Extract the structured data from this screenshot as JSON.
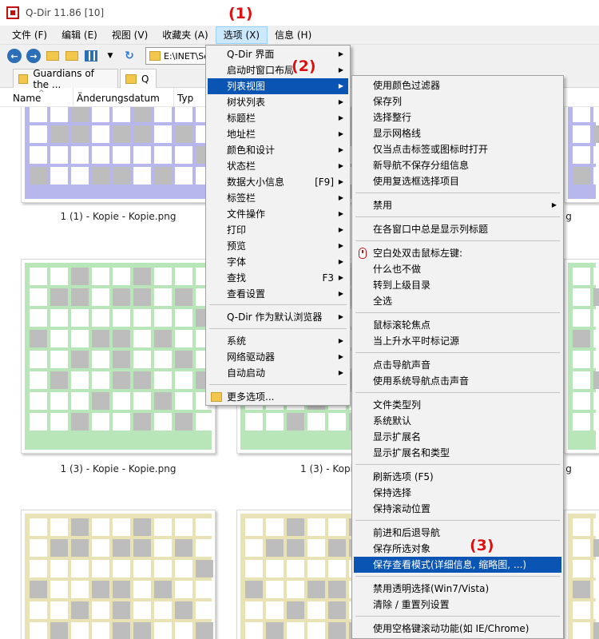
{
  "window": {
    "title": "Q-Dir 11.86 [10]"
  },
  "menubar": [
    {
      "label": "文件 (F)"
    },
    {
      "label": "编辑 (E)"
    },
    {
      "label": "视图 (V)"
    },
    {
      "label": "收藏夹 (A)"
    },
    {
      "label": "选项 (X)"
    },
    {
      "label": "信息 (H)"
    }
  ],
  "toolbar": {
    "address": "E:\\INET\\So"
  },
  "tabs": [
    {
      "label": "Guardians of the ..."
    },
    {
      "label": "Q"
    }
  ],
  "columns": [
    {
      "label": "Name"
    },
    {
      "label": "Änderungsdatum"
    },
    {
      "label": "Typ"
    }
  ],
  "files": [
    {
      "caption": "1 (1) - Kopie - Kopie.png",
      "color": "#b7b7ee"
    },
    {
      "caption": "1 (3) - Kopie - Kopie.png",
      "color": "#b8e6b8"
    },
    {
      "caption": "1 (3) - Kopie",
      "color": "#b8e6b8"
    },
    {
      "caption": "",
      "color": "#e8e2b4"
    },
    {
      "caption": "",
      "color": "#e8e2b4"
    }
  ],
  "captions_right": {
    "row1": "g",
    "row2": "g"
  },
  "options_menu": [
    {
      "label": "Q-Dir 界面",
      "arrow": true
    },
    {
      "label": "启动时窗口布局",
      "arrow": true
    },
    {
      "label": "列表视图",
      "arrow": true,
      "highlight": true
    },
    {
      "label": "树状列表",
      "arrow": true
    },
    {
      "label": "标题栏",
      "arrow": true
    },
    {
      "label": "地址栏",
      "arrow": true
    },
    {
      "label": "颜色和设计",
      "arrow": true
    },
    {
      "label": "状态栏",
      "arrow": true
    },
    {
      "label": "数据大小信息",
      "shortcut": "[F9]",
      "arrow": true
    },
    {
      "label": "标签栏",
      "arrow": true
    },
    {
      "label": "文件操作",
      "arrow": true
    },
    {
      "label": "打印",
      "arrow": true
    },
    {
      "label": "预览",
      "arrow": true
    },
    {
      "label": "字体",
      "arrow": true
    },
    {
      "label": "查找",
      "shortcut": "F3",
      "arrow": true
    },
    {
      "label": "查看设置",
      "arrow": true
    },
    {
      "label": "Q-Dir 作为默认浏览器",
      "arrow": true
    },
    {
      "label": "系统",
      "arrow": true
    },
    {
      "label": "网络驱动器",
      "arrow": true
    },
    {
      "label": "自动启动",
      "arrow": true
    },
    {
      "label": "更多选项...",
      "arrow": false,
      "folder_icon": true
    }
  ],
  "listview_menu": [
    {
      "label": "使用颜色过滤器"
    },
    {
      "label": "保存列"
    },
    {
      "label": "选择整行"
    },
    {
      "label": "显示网格线"
    },
    {
      "label": "仅当点击标签或图标时打开"
    },
    {
      "label": "新导航不保存分组信息"
    },
    {
      "label": "使用复选框选择项目"
    },
    {
      "label": "禁用",
      "arrow": true
    },
    {
      "label": "在各窗口中总是显示列标题"
    },
    {
      "label": "空白处双击鼠标左键:",
      "mouse_icon": true
    },
    {
      "label": "什么也不做"
    },
    {
      "label": "转到上级目录"
    },
    {
      "label": "全选"
    },
    {
      "label": "鼠标滚轮焦点"
    },
    {
      "label": "当上升水平时标记源"
    },
    {
      "label": "点击导航声音"
    },
    {
      "label": "使用系统导航点击声音"
    },
    {
      "label": "文件类型列"
    },
    {
      "label": "系统默认"
    },
    {
      "label": "显示扩展名"
    },
    {
      "label": "显示扩展名和类型"
    },
    {
      "label": "刷新选项 (F5)"
    },
    {
      "label": "保持选择"
    },
    {
      "label": "保持滚动位置"
    },
    {
      "label": "前进和后退导航"
    },
    {
      "label": "保存所选对象"
    },
    {
      "label": "保存查看模式(详细信息, 缩略图, ...)",
      "highlight": true
    },
    {
      "label": "禁用透明选择(Win7/Vista)"
    },
    {
      "label": "清除 / 重置列设置"
    },
    {
      "label": "使用空格键滚动功能(如 IE/Chrome)"
    }
  ],
  "callouts": [
    {
      "label": "(1)"
    },
    {
      "label": "(2)"
    },
    {
      "label": "(3)"
    }
  ],
  "colors": {
    "menu_highlight": "#0a54b3",
    "callout": "#e01010",
    "menubar_active": "#cce8ff"
  }
}
